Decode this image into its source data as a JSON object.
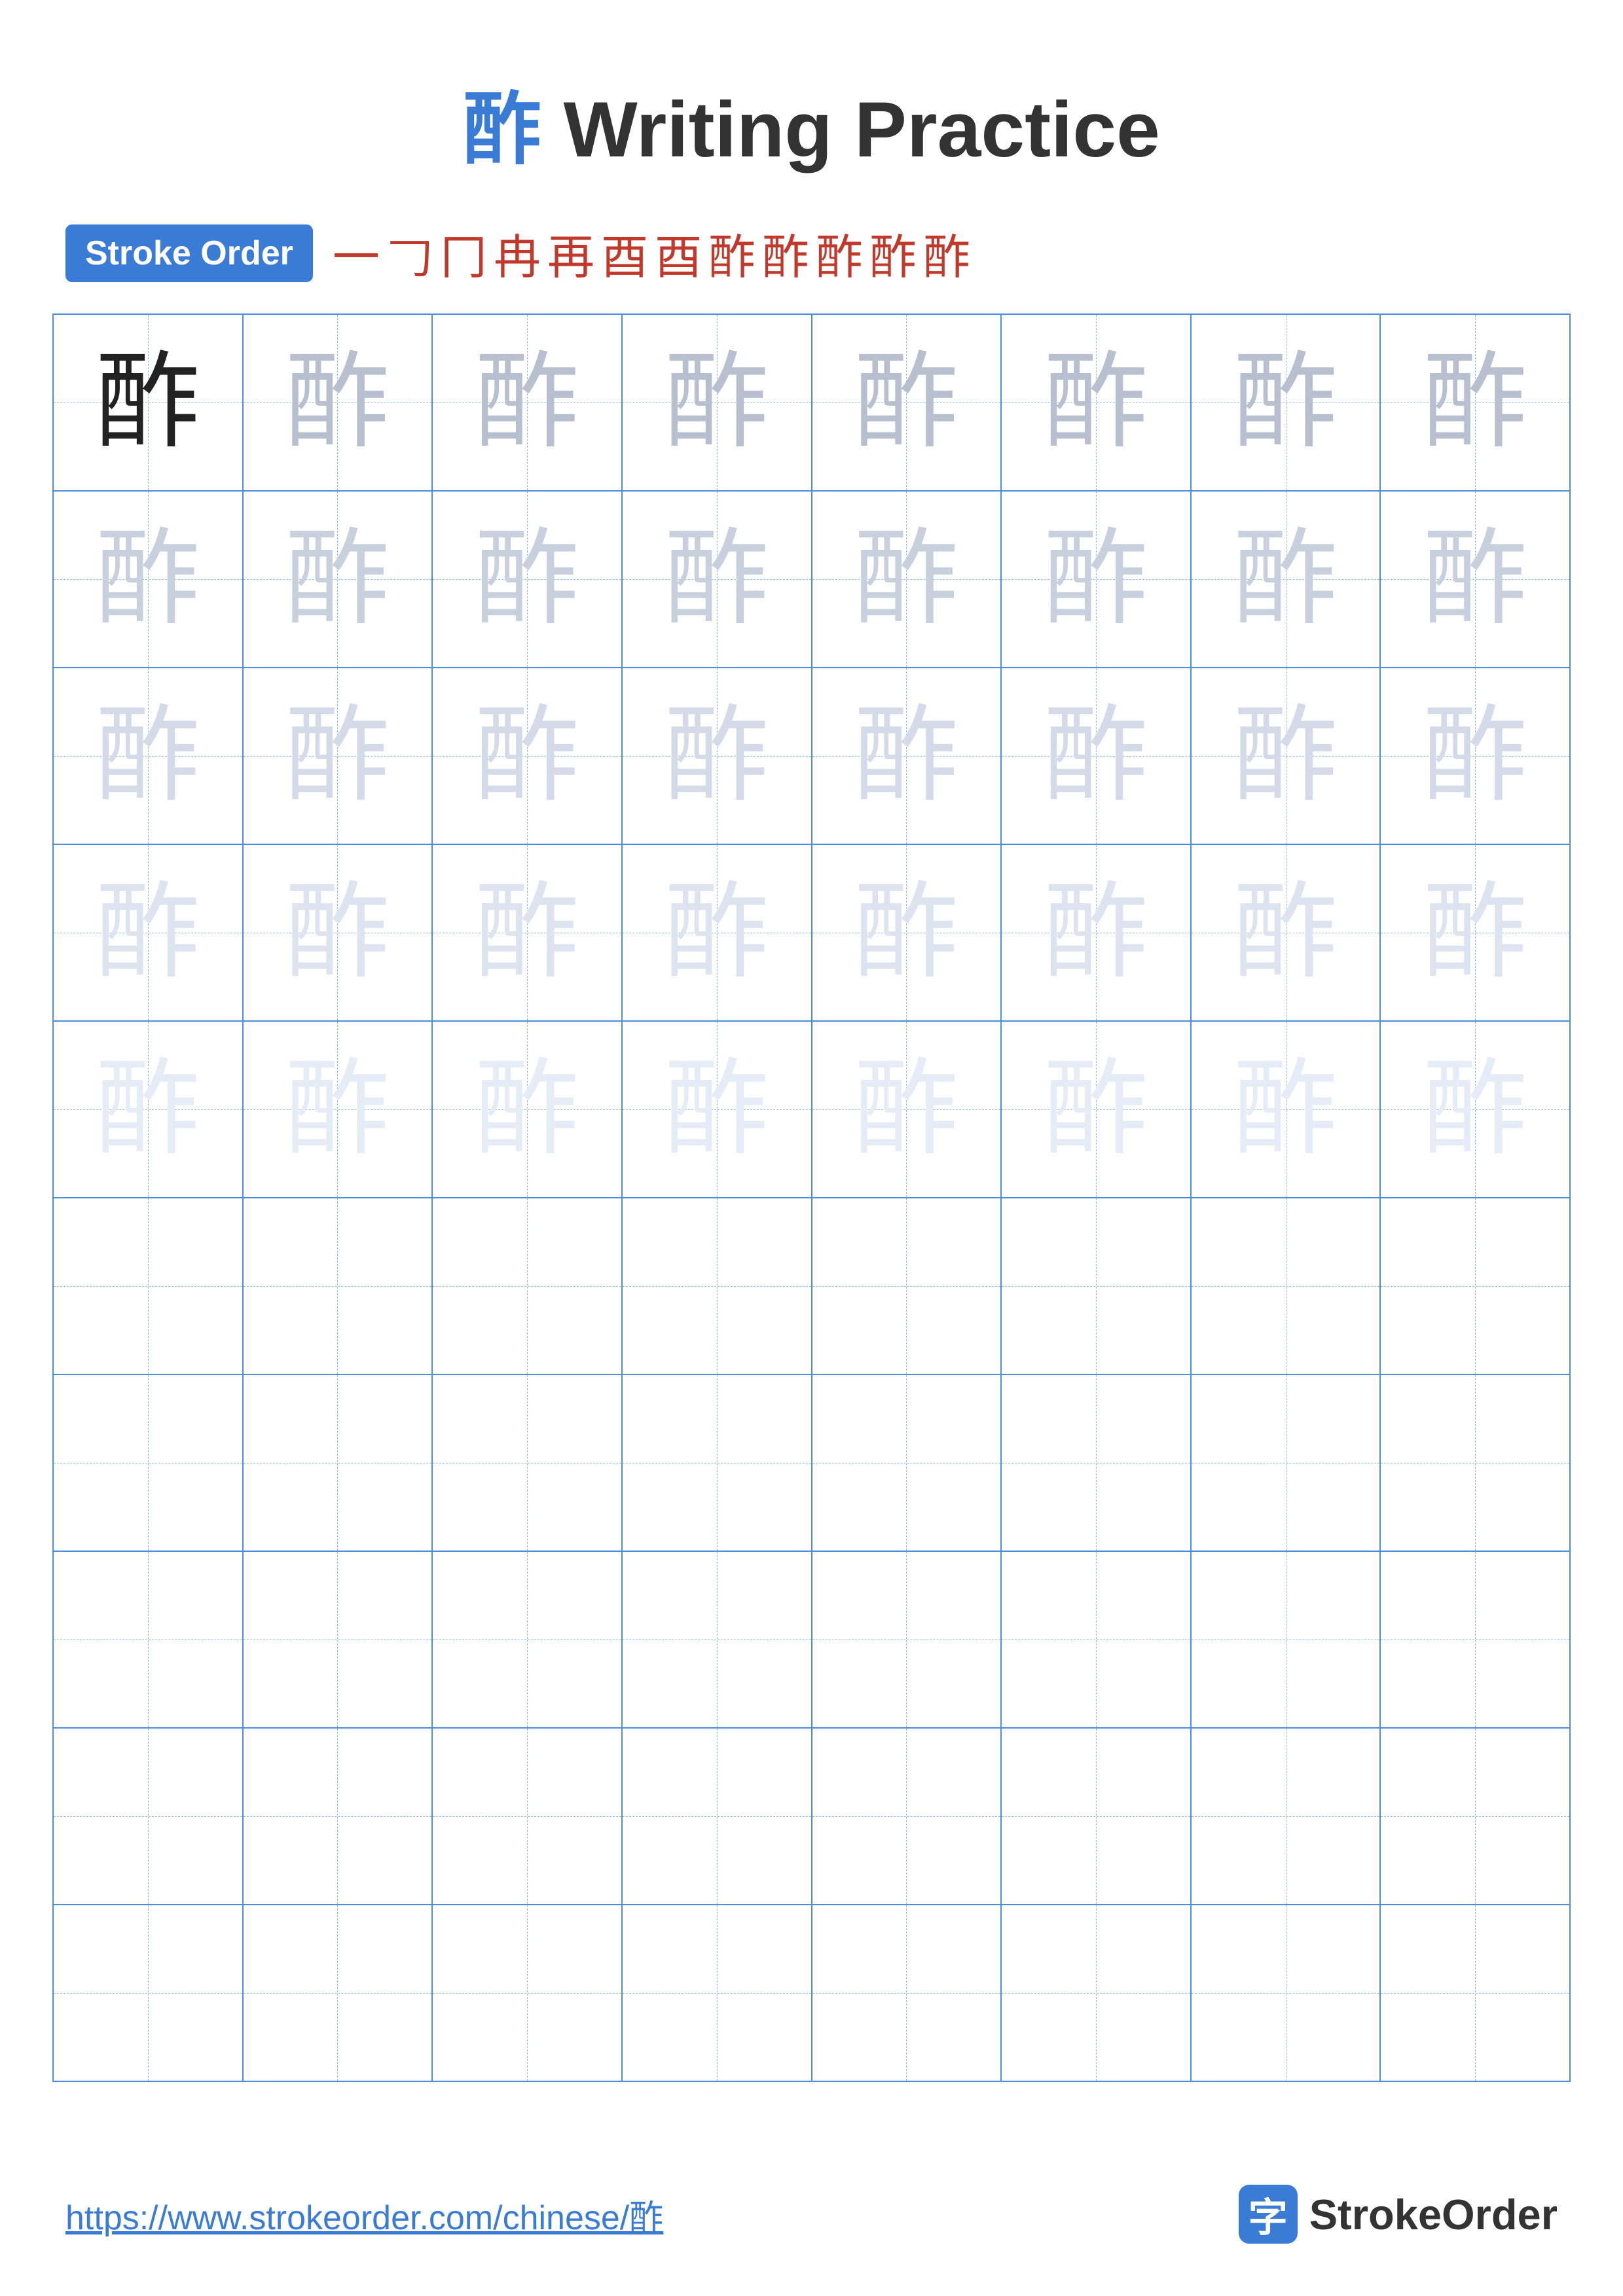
{
  "title": {
    "char": "酢",
    "label": "Writing Practice"
  },
  "stroke_order": {
    "badge": "Stroke Order",
    "steps": [
      "一",
      "𠃌",
      "冂",
      "冉",
      "再",
      "酉",
      "酉",
      "酢'",
      "酢'",
      "酢",
      "酢",
      "酢"
    ]
  },
  "grid": {
    "char": "酢",
    "rows": 10,
    "cols": 8
  },
  "footer": {
    "url": "https://www.strokeorder.com/chinese/酢",
    "brand_icon": "字",
    "brand_name": "StrokeOrder"
  }
}
